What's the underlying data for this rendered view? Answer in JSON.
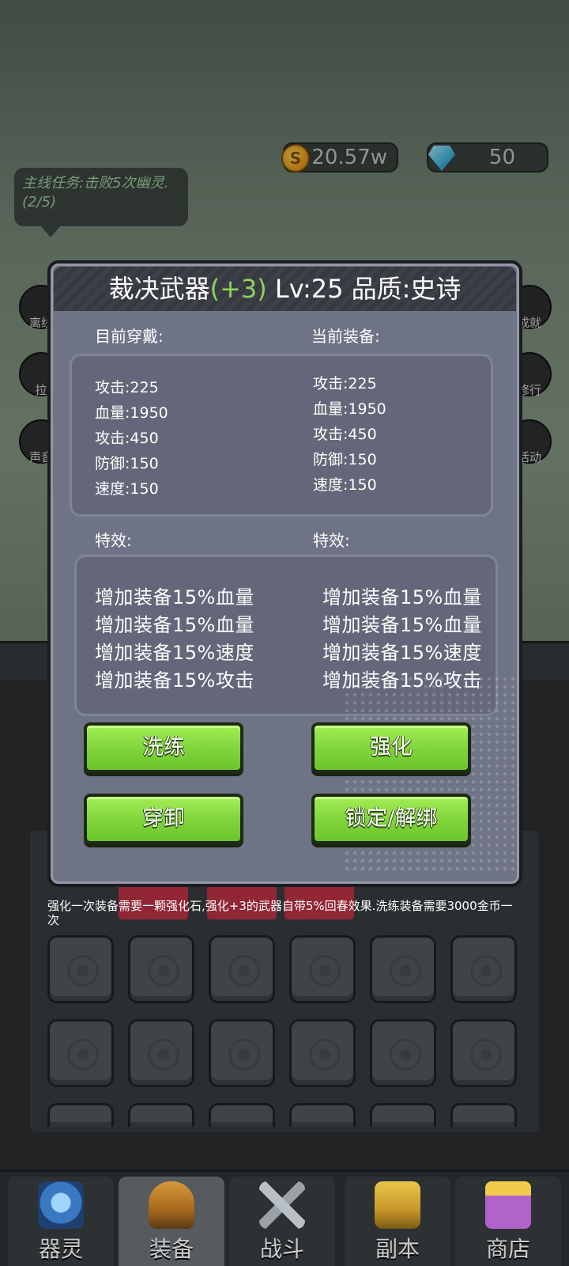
{
  "resources": {
    "gold": "20.57w",
    "gems": "50"
  },
  "quest": {
    "text": "主线任务:击败5次幽灵.(2/5)"
  },
  "side_buttons": {
    "left": [
      "离线",
      "拉",
      "声音"
    ],
    "right": [
      "成就",
      "修行",
      "活动"
    ]
  },
  "dialog": {
    "title_name": "裁决武器",
    "title_plus": "(+3)",
    "title_rest": " Lv:25 品质:史诗",
    "current_wearing_label": "目前穿戴:",
    "current_equip_label": "当前装备:",
    "left_stats": [
      "攻击:225",
      "血量:1950",
      "攻击:450",
      "防御:150",
      "速度:150"
    ],
    "right_stats": [
      "攻击:225",
      "血量:1950",
      "攻击:450",
      "防御:150",
      "速度:150"
    ],
    "effects_label_left": "特效:",
    "effects_label_right": "特效:",
    "left_effects": [
      "增加装备15%血量",
      "增加装备15%血量",
      "增加装备15%速度",
      "增加装备15%攻击"
    ],
    "right_effects": [
      "增加装备15%血量",
      "增加装备15%血量",
      "增加装备15%速度",
      "增加装备15%攻击"
    ],
    "buttons": {
      "refine": "洗练",
      "enhance": "强化",
      "equip_unequip": "穿卸",
      "lock_unbind": "锁定/解绑"
    }
  },
  "info_text": "强化一次装备需要一颗强化石,强化+3的武器自带5%回春效果.洗练装备需要3000金币一次",
  "bottom_nav": [
    {
      "label": "器灵",
      "icon": "spirit-icon",
      "active": false
    },
    {
      "label": "装备",
      "icon": "helmet-icon",
      "active": true
    },
    {
      "label": "战斗",
      "icon": "swords-icon",
      "active": false
    },
    {
      "label": "副本",
      "icon": "dungeon-icon",
      "active": false
    },
    {
      "label": "商店",
      "icon": "chest-icon",
      "active": false
    }
  ],
  "colors": {
    "dialog_bg": "#6e7386",
    "button_green": "#8be046",
    "plus_green": "#8fd45b",
    "quest_text": "#a9d6ac"
  }
}
